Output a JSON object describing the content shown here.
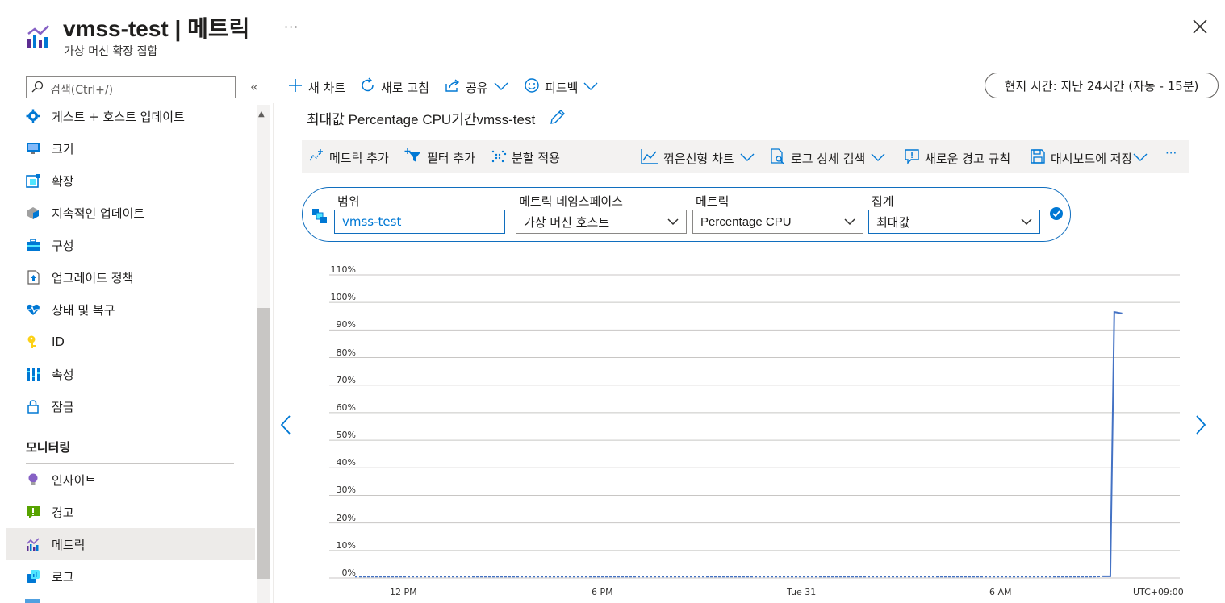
{
  "header": {
    "title": "vmss-test | 메트릭",
    "subtitle": "가상 머신 확장 집합",
    "more": "···"
  },
  "sidebar": {
    "search_placeholder": "검색(Ctrl+/)",
    "collapse": "«",
    "items": [
      {
        "label": "게스트 + 호스트 업데이트",
        "icon": "gear-icon"
      },
      {
        "label": "크기",
        "icon": "monitor-icon"
      },
      {
        "label": "확장",
        "icon": "extension-icon"
      },
      {
        "label": "지속적인 업데이트",
        "icon": "update-icon"
      },
      {
        "label": "구성",
        "icon": "toolbox-icon"
      },
      {
        "label": "업그레이드 정책",
        "icon": "upgrade-icon"
      },
      {
        "label": "상태 및 복구",
        "icon": "heart-icon"
      },
      {
        "label": "ID",
        "icon": "key-icon"
      },
      {
        "label": "속성",
        "icon": "properties-icon"
      },
      {
        "label": "잠금",
        "icon": "lock-icon"
      }
    ],
    "section_monitoring": "모니터링",
    "monitoring_items": [
      {
        "label": "인사이트",
        "icon": "lightbulb-icon"
      },
      {
        "label": "경고",
        "icon": "alert-icon"
      },
      {
        "label": "메트릭",
        "icon": "metrics-icon"
      },
      {
        "label": "로그",
        "icon": "logs-icon"
      }
    ]
  },
  "toolbar": {
    "new_chart": "새 차트",
    "refresh": "새로 고침",
    "share": "공유",
    "feedback": "피드백",
    "time_range": "현지 시간: 지난 24시간 (자동 - 15분)"
  },
  "chart": {
    "title": "최대값 Percentage CPU기간vmss-test",
    "toolbar": {
      "add_metric": "메트릭 추가",
      "add_filter": "필터 추가",
      "apply_split": "분할 적용",
      "line_chart": "꺾은선형 차트",
      "log_search": "로그 상세 검색",
      "new_alert": "새로운 경고 규칙",
      "save_dashboard": "대시보드에 저장",
      "more": "···"
    },
    "scope_label": "범위",
    "scope_value": "vmss-test",
    "namespace_label": "메트릭 네임스페이스",
    "namespace_value": "가상 머신 호스트",
    "metric_label": "메트릭",
    "metric_value": "Percentage CPU",
    "aggregation_label": "집계",
    "aggregation_value": "최대값"
  },
  "chart_data": {
    "type": "line",
    "y_ticks": [
      "110%",
      "100%",
      "90%",
      "80%",
      "70%",
      "60%",
      "50%",
      "40%",
      "30%",
      "20%",
      "10%",
      "0%"
    ],
    "x_ticks": [
      "12 PM",
      "6 PM",
      "Tue 31",
      "6 AM",
      "UTC+09:00"
    ],
    "ylim": [
      0,
      110
    ],
    "series": [
      {
        "color": "#4472c4",
        "x": [
          0,
          0.05,
          0.1,
          0.2,
          0.3,
          0.4,
          0.5,
          0.6,
          0.7,
          0.8,
          0.9,
          0.93,
          0.945,
          0.955,
          0.96,
          0.97
        ],
        "y": [
          0.5,
          0.5,
          0.5,
          0.5,
          0.5,
          0.5,
          0.5,
          0.5,
          0.5,
          0.5,
          0.5,
          0.5,
          0.6,
          0.6,
          96.5,
          96
        ]
      }
    ]
  },
  "colors": {
    "accent": "#0078d4",
    "line": "#4472c4"
  }
}
